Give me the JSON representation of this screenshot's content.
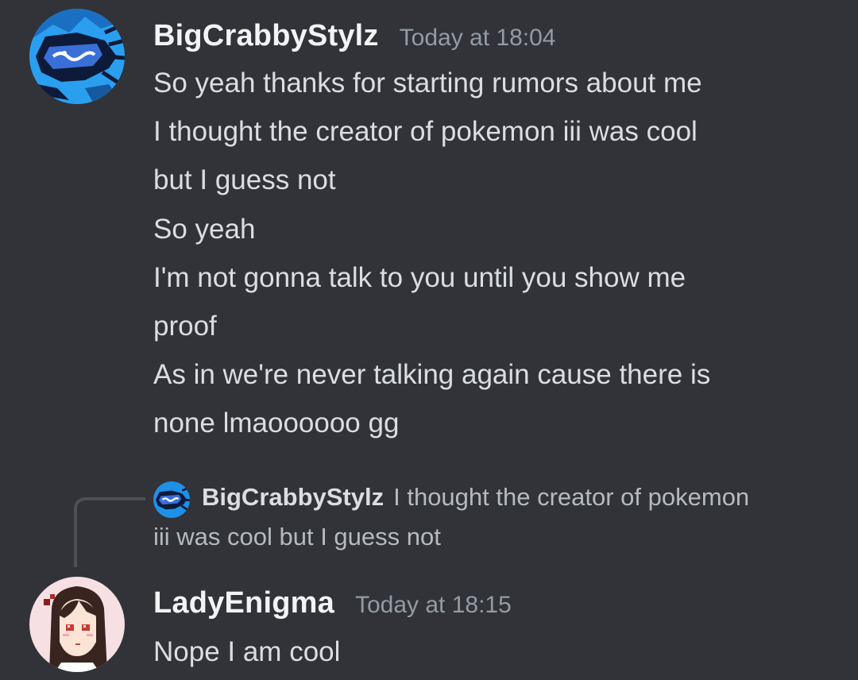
{
  "messages": [
    {
      "username": "BigCrabbyStylz",
      "timestamp": "Today at 18:04",
      "avatar_icon": "blue-creature-avatar",
      "lines": [
        "So yeah thanks for starting rumors about me",
        "I thought the creator of pokemon iii was cool",
        "but I guess not",
        "So yeah",
        "I'm not gonna talk to you until you show me",
        "proof",
        "As in we're never talking again cause there is",
        "none lmaoooooo gg"
      ]
    },
    {
      "username": "LadyEnigma",
      "timestamp": "Today at 18:15",
      "avatar_icon": "pixel-art-girl-avatar",
      "reply": {
        "username": "BigCrabbyStylz",
        "text_line1": "I thought the creator of pokemon",
        "text_line2": "iii was cool but I guess not"
      },
      "lines": [
        "Nope I am cool"
      ]
    }
  ],
  "colors": {
    "background": "#313338",
    "username": "#f2f3f5",
    "timestamp": "#949ba4",
    "message_text": "#dbdee1",
    "reply_text": "#b5bac1",
    "reply_spine": "#4e5058"
  }
}
